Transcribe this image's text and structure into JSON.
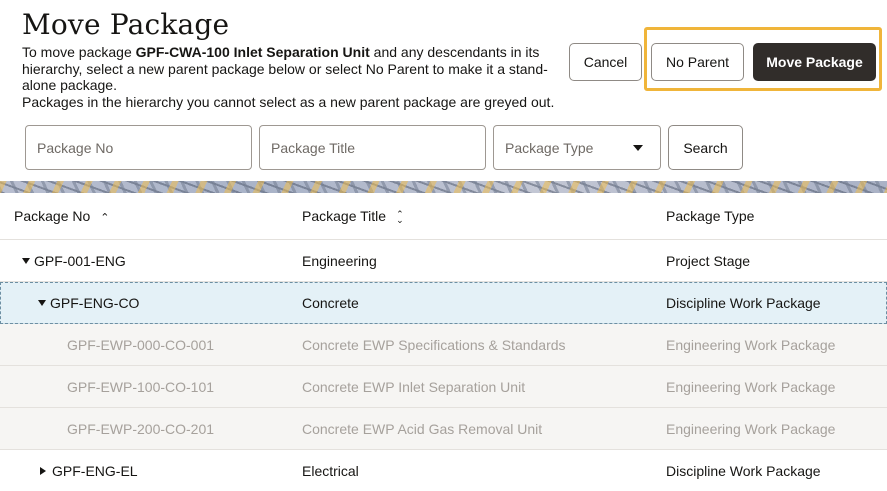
{
  "dialog": {
    "title": "Move Package",
    "desc_prefix": "To move package ",
    "desc_package": "GPF-CWA-100 Inlet Separation Unit",
    "desc_suffix": " and any descendants in its hierarchy, select a new parent package below or select No Parent to make it a stand-alone package.",
    "desc_line2": "Packages in the hierarchy you cannot select as a new parent package are greyed out."
  },
  "buttons": {
    "cancel": "Cancel",
    "no_parent": "No Parent",
    "move_package": "Move Package",
    "search": "Search"
  },
  "filters": {
    "package_no_placeholder": "Package No",
    "package_title_placeholder": "Package Title",
    "package_type_placeholder": "Package Type"
  },
  "colors": {
    "highlight": "#f0b53a",
    "primary_button": "#312d2a",
    "selected_row": "#e4f1f7"
  },
  "table": {
    "headers": [
      "Package No",
      "Package Title",
      "Package Type"
    ],
    "rows": [
      {
        "no": "GPF-001-ENG",
        "title": "Engineering",
        "type": "Project Stage",
        "level": 0,
        "expander": "expanded",
        "state": "normal"
      },
      {
        "no": "GPF-ENG-CO",
        "title": "Concrete",
        "type": "Discipline Work Package",
        "level": 1,
        "expander": "expanded",
        "state": "selected"
      },
      {
        "no": "GPF-EWP-000-CO-001",
        "title": "Concrete EWP Specifications & Standards",
        "type": "Engineering Work Package",
        "level": 2,
        "expander": "none",
        "state": "disabled"
      },
      {
        "no": "GPF-EWP-100-CO-101",
        "title": "Concrete EWP Inlet Separation Unit",
        "type": "Engineering Work Package",
        "level": 2,
        "expander": "none",
        "state": "disabled"
      },
      {
        "no": "GPF-EWP-200-CO-201",
        "title": "Concrete EWP Acid Gas Removal Unit",
        "type": "Engineering Work Package",
        "level": 2,
        "expander": "none",
        "state": "disabled"
      },
      {
        "no": "GPF-ENG-EL",
        "title": "Electrical",
        "type": "Discipline Work Package",
        "level": 1,
        "expander": "collapsed",
        "state": "normal"
      }
    ]
  }
}
